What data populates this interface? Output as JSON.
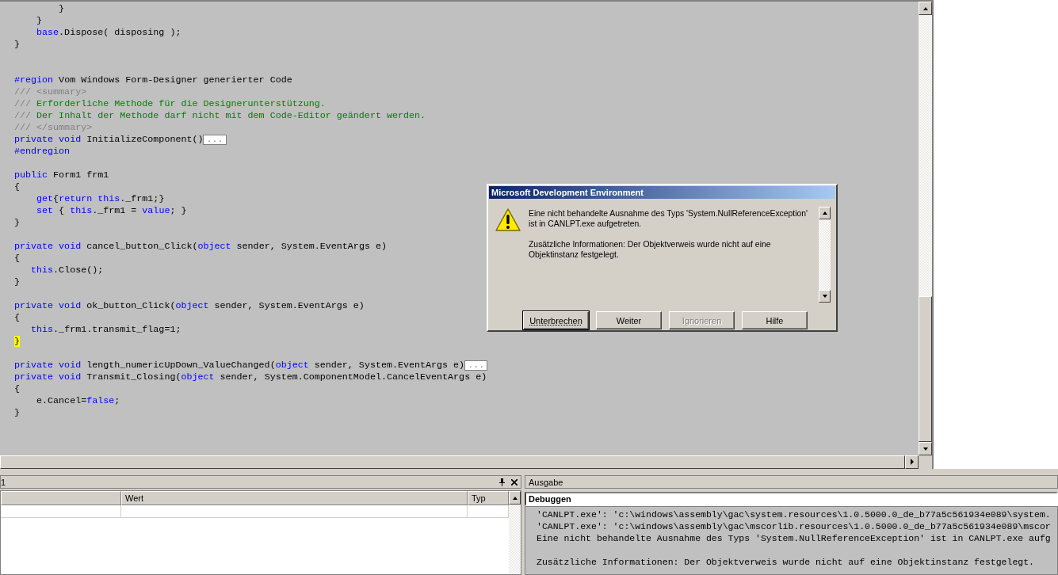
{
  "editor": {
    "lines": [
      {
        "kind": "code",
        "tokens": [
          {
            "kind": "plain",
            "text": "        }"
          }
        ]
      },
      {
        "kind": "code",
        "tokens": [
          {
            "kind": "plain",
            "text": "    }"
          }
        ]
      },
      {
        "kind": "code",
        "tokens": [
          {
            "kind": "keyword",
            "text": "    base"
          },
          {
            "kind": "plain",
            "text": ".Dispose( disposing );"
          }
        ]
      },
      {
        "kind": "code",
        "tokens": [
          {
            "kind": "plain",
            "text": "}"
          }
        ]
      },
      {
        "kind": "blank"
      },
      {
        "kind": "blank"
      },
      {
        "kind": "code",
        "tokens": [
          {
            "kind": "keyword",
            "text": "#region"
          },
          {
            "kind": "plain",
            "text": " Vom Windows Form-Designer generierter Code"
          }
        ]
      },
      {
        "kind": "code",
        "tokens": [
          {
            "kind": "doc",
            "text": "/// <summary>"
          }
        ]
      },
      {
        "kind": "code",
        "tokens": [
          {
            "kind": "doc",
            "text": "/// "
          },
          {
            "kind": "comment",
            "text": "Erforderliche Methode für die Designerunterstützung."
          }
        ]
      },
      {
        "kind": "code",
        "tokens": [
          {
            "kind": "doc",
            "text": "/// "
          },
          {
            "kind": "comment",
            "text": "Der Inhalt der Methode darf nicht mit dem Code-Editor geändert werden."
          }
        ]
      },
      {
        "kind": "code",
        "tokens": [
          {
            "kind": "doc",
            "text": "/// </summary>"
          }
        ]
      },
      {
        "kind": "code",
        "tokens": [
          {
            "kind": "keyword",
            "text": "private void"
          },
          {
            "kind": "plain",
            "text": " InitializeComponent()"
          },
          {
            "kind": "collapsed",
            "text": "..."
          }
        ]
      },
      {
        "kind": "code",
        "tokens": [
          {
            "kind": "keyword",
            "text": "#endregion"
          }
        ]
      },
      {
        "kind": "blank"
      },
      {
        "kind": "code",
        "tokens": [
          {
            "kind": "keyword",
            "text": "public"
          },
          {
            "kind": "plain",
            "text": " Form1 frm1"
          }
        ]
      },
      {
        "kind": "code",
        "tokens": [
          {
            "kind": "plain",
            "text": "{"
          }
        ]
      },
      {
        "kind": "code",
        "tokens": [
          {
            "kind": "keyword",
            "text": "    get"
          },
          {
            "kind": "plain",
            "text": "{"
          },
          {
            "kind": "keyword",
            "text": "return this"
          },
          {
            "kind": "plain",
            "text": "._frm1;}"
          }
        ]
      },
      {
        "kind": "code",
        "tokens": [
          {
            "kind": "keyword",
            "text": "    set"
          },
          {
            "kind": "plain",
            "text": " { "
          },
          {
            "kind": "keyword",
            "text": "this"
          },
          {
            "kind": "plain",
            "text": "._frm1 = "
          },
          {
            "kind": "keyword",
            "text": "value"
          },
          {
            "kind": "plain",
            "text": "; }"
          }
        ]
      },
      {
        "kind": "code",
        "tokens": [
          {
            "kind": "plain",
            "text": "}"
          }
        ]
      },
      {
        "kind": "blank"
      },
      {
        "kind": "code",
        "tokens": [
          {
            "kind": "keyword",
            "text": "private void"
          },
          {
            "kind": "plain",
            "text": " cancel_button_Click("
          },
          {
            "kind": "keyword",
            "text": "object"
          },
          {
            "kind": "plain",
            "text": " sender, System.EventArgs e)"
          }
        ]
      },
      {
        "kind": "code",
        "tokens": [
          {
            "kind": "plain",
            "text": "{"
          }
        ]
      },
      {
        "kind": "code",
        "tokens": [
          {
            "kind": "keyword",
            "text": "   this"
          },
          {
            "kind": "plain",
            "text": ".Close();"
          }
        ]
      },
      {
        "kind": "code",
        "tokens": [
          {
            "kind": "plain",
            "text": "}"
          }
        ]
      },
      {
        "kind": "blank"
      },
      {
        "kind": "code",
        "tokens": [
          {
            "kind": "keyword",
            "text": "private void"
          },
          {
            "kind": "plain",
            "text": " ok_button_Click("
          },
          {
            "kind": "keyword",
            "text": "object"
          },
          {
            "kind": "plain",
            "text": " sender, System.EventArgs e)"
          }
        ]
      },
      {
        "kind": "code",
        "tokens": [
          {
            "kind": "plain",
            "text": "{"
          }
        ]
      },
      {
        "kind": "code",
        "tokens": [
          {
            "kind": "keyword",
            "text": "   this"
          },
          {
            "kind": "plain",
            "text": "._frm1.transmit_flag=1;"
          }
        ]
      },
      {
        "kind": "code",
        "tokens": [
          {
            "kind": "highlight",
            "text": "}"
          }
        ]
      },
      {
        "kind": "blank"
      },
      {
        "kind": "code",
        "tokens": [
          {
            "kind": "keyword",
            "text": "private void"
          },
          {
            "kind": "plain",
            "text": " length_numericUpDown_ValueChanged("
          },
          {
            "kind": "keyword",
            "text": "object"
          },
          {
            "kind": "plain",
            "text": " sender, System.EventArgs e)"
          },
          {
            "kind": "collapsed",
            "text": "..."
          }
        ]
      },
      {
        "kind": "code",
        "tokens": [
          {
            "kind": "keyword",
            "text": "private void"
          },
          {
            "kind": "plain",
            "text": " Transmit_Closing("
          },
          {
            "kind": "keyword",
            "text": "object"
          },
          {
            "kind": "plain",
            "text": " sender, System.ComponentModel.CancelEventArgs e)"
          }
        ]
      },
      {
        "kind": "code",
        "tokens": [
          {
            "kind": "plain",
            "text": "{"
          }
        ]
      },
      {
        "kind": "code",
        "tokens": [
          {
            "kind": "plain",
            "text": "    e.Cancel="
          },
          {
            "kind": "keyword",
            "text": "false"
          },
          {
            "kind": "plain",
            "text": ";"
          }
        ]
      },
      {
        "kind": "code",
        "tokens": [
          {
            "kind": "plain",
            "text": "}"
          }
        ]
      }
    ]
  },
  "error_dialog": {
    "title": "Microsoft Development Environment",
    "paragraphs": [
      "Eine nicht behandelte Ausnahme des Typs 'System.NullReferenceException' ist in CANLPT.exe aufgetreten.",
      "Zusätzliche Informationen: Der Objektverweis wurde nicht auf eine Objektinstanz festgelegt."
    ],
    "buttons": [
      {
        "label": "Unterbrechen",
        "default": true,
        "disabled": false
      },
      {
        "label": "Weiter",
        "default": false,
        "disabled": false
      },
      {
        "label": "Ignorieren",
        "default": false,
        "disabled": true
      },
      {
        "label": "Hilfe",
        "default": false,
        "disabled": false
      }
    ]
  },
  "locals_panel": {
    "title": "1",
    "columns": [
      "Wert",
      "Typ"
    ]
  },
  "output_panel": {
    "title": "Ausgabe",
    "pane": "Debuggen",
    "lines": [
      {
        "kind": "text",
        "text": "'CANLPT.exe': 'c:\\windows\\assembly\\gac\\system.resources\\1.0.5000.0_de_b77a5c561934e089\\system."
      },
      {
        "kind": "text",
        "text": "'CANLPT.exe': 'c:\\windows\\assembly\\gac\\mscorlib.resources\\1.0.5000.0_de_b77a5c561934e089\\mscor"
      },
      {
        "kind": "text",
        "text": "Eine nicht behandelte Ausnahme des Typs 'System.NullReferenceException' ist in CANLPT.exe aufg"
      },
      {
        "kind": "blank"
      },
      {
        "kind": "text",
        "text": "Zusätzliche Informationen: Der Objektverweis wurde nicht auf eine Objektinstanz festgelegt."
      }
    ]
  }
}
